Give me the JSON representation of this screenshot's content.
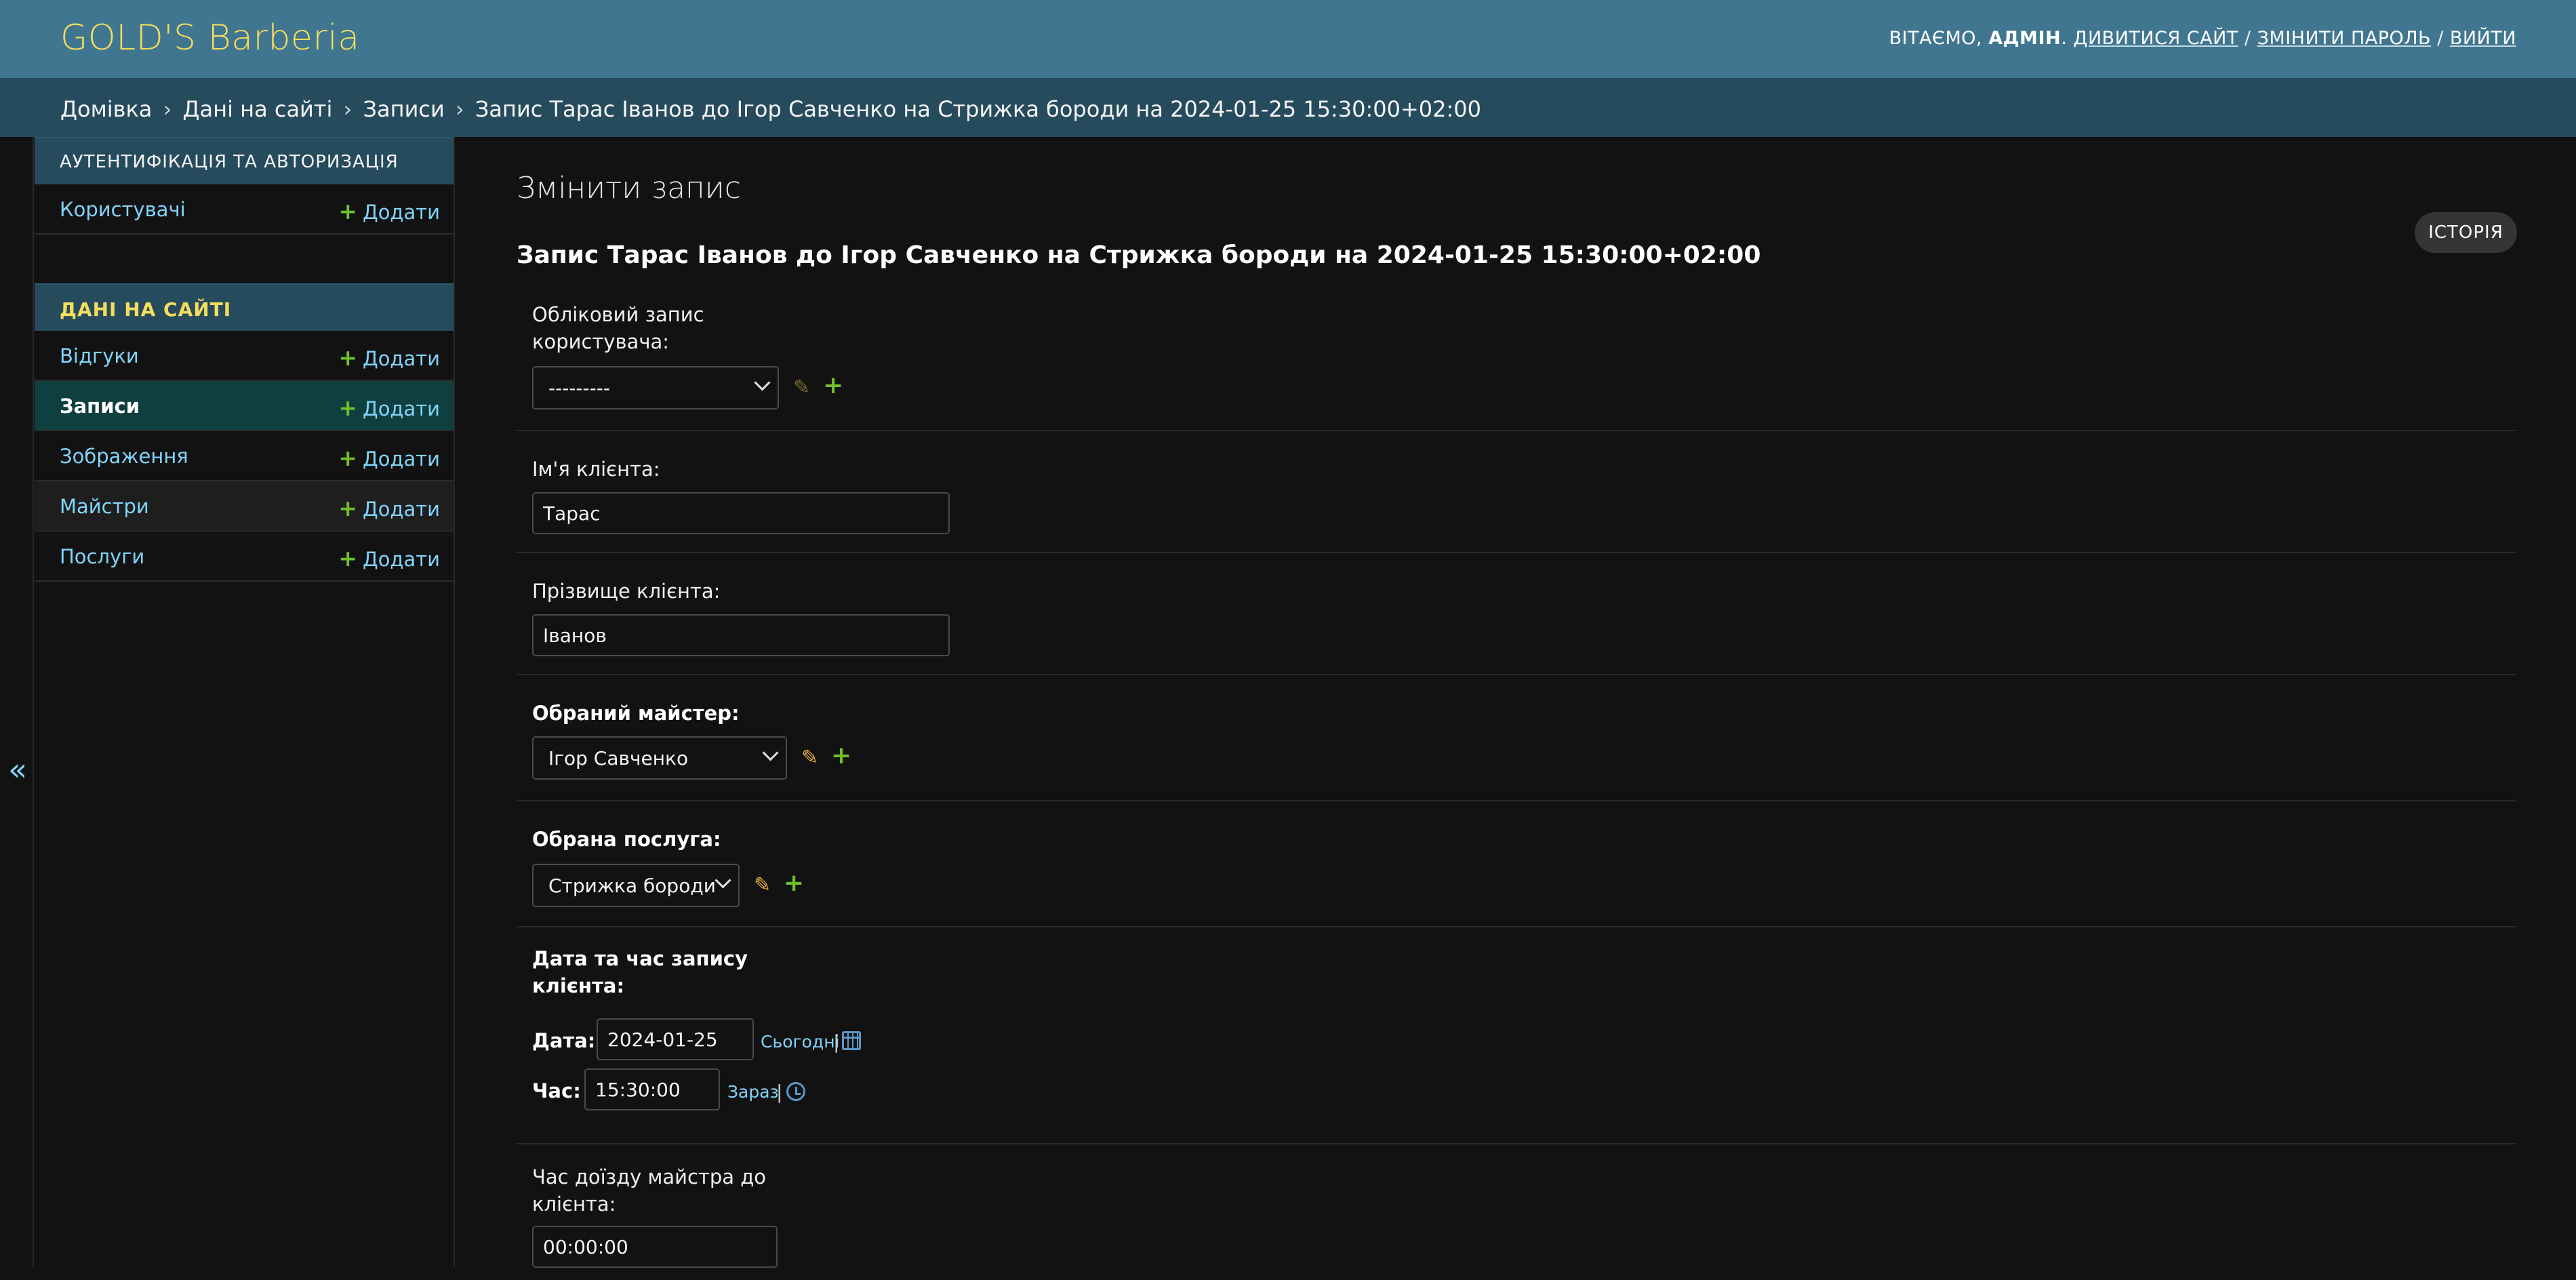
{
  "header": {
    "brand": "GOLD'S Barberia",
    "welcome": "ВІТАЄМО,",
    "username": "АДМІН",
    "view_site": "ДИВИТИСЯ САЙТ",
    "change_password": "ЗМІНИТИ ПАРОЛЬ",
    "logout": "ВИЙТИ",
    "separator": "/"
  },
  "breadcrumbs": {
    "home": "Домівка",
    "app": "Дані на сайті",
    "model": "Записи",
    "current": "Запис Тарас Іванов до Ігор Савченко на Стрижка бороди на 2024-01-25 15:30:00+02:00",
    "arrow": "›"
  },
  "nav_toggle": "«",
  "sidebar": {
    "add_label": "Додати",
    "add_symbol": "+",
    "apps": [
      {
        "caption": "Аутентифікація та авторизація",
        "models": [
          {
            "name": "Користувачі"
          }
        ]
      },
      {
        "caption": "Дані на сайті",
        "models": [
          {
            "name": "Відгуки"
          },
          {
            "name": "Записи"
          },
          {
            "name": "Зображення"
          },
          {
            "name": "Майстри"
          },
          {
            "name": "Послуги"
          }
        ]
      }
    ]
  },
  "content": {
    "title": "Змінити запис",
    "history_button": "ІСТОРІЯ",
    "object_title": "Запис Тарас Іванов до Ігор Савченко на Стрижка бороди на 2024-01-25 15:30:00+02:00"
  },
  "form": {
    "user_account": {
      "label_line1": "Обліковий запис",
      "label_line2": "користувача:",
      "value": "---------"
    },
    "first_name": {
      "label": "Ім'я клієнта:",
      "value": "Тарас"
    },
    "last_name": {
      "label": "Прізвище клієнта:",
      "value": "Іванов"
    },
    "master": {
      "label": "Обраний майстер:",
      "value": "Ігор Савченко"
    },
    "service": {
      "label": "Обрана послуга:",
      "value": "Стрижка бороди"
    },
    "datetime": {
      "label_line1": "Дата та час запису",
      "label_line2": "клієнта:",
      "date_label": "Дата:",
      "date_value": "2024-01-25",
      "today_link": "Сьогодні",
      "time_label": "Час:",
      "time_value": "15:30:00",
      "now_link": "Зараз",
      "pipe": "|"
    },
    "travel_time": {
      "label_line1": "Час доїзду майстра до",
      "label_line2": "клієнта:",
      "value": "00:00:00"
    }
  },
  "colors": {
    "header_bg": "#417690",
    "breadcrumbs_bg": "#264b5d",
    "brand": "#f5dd5d",
    "link": "#81d4fa",
    "add_plus": "#70bf2b",
    "current_row": "#0f3f3f",
    "page_bg": "#121212"
  }
}
